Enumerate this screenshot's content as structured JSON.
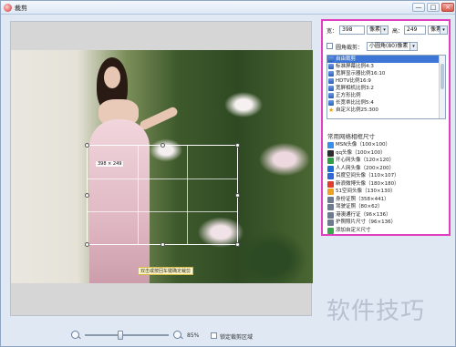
{
  "window": {
    "title": "裁剪"
  },
  "titlebar_buttons": {
    "minimize": "—",
    "maximize": "□",
    "close": "×"
  },
  "canvas": {
    "crop_size_label": "398 × 249",
    "crop_tip": "双击或按回车键确定裁剪"
  },
  "zoom": {
    "percent": "85%",
    "lock_label": "锁定裁剪区域",
    "level": 0.42
  },
  "panel": {
    "width_label": "宽：",
    "width_value": "398",
    "width_unit": "像素",
    "height_label": "高：",
    "height_value": "249",
    "height_unit": "像素",
    "corner_label": "圆角裁剪：",
    "corner_value": "小圆角(80)像素",
    "ratios": [
      {
        "label": "自由裁剪",
        "selected": true
      },
      {
        "label": "标准屏幕比例4:3",
        "selected": false
      },
      {
        "label": "宽屏显示器比例16:10",
        "selected": false
      },
      {
        "label": "HDTV比例16:9",
        "selected": false
      },
      {
        "label": "宽屏相机比例3:2",
        "selected": false
      },
      {
        "label": "正方形比例",
        "selected": false
      },
      {
        "label": "长宽帚比比例5:4",
        "selected": false
      },
      {
        "label": "自定义比例25:300",
        "selected": false,
        "star": true
      }
    ],
    "common_title": "常用网络相框尺寸",
    "common_items": [
      {
        "label": "MSN头像（100×100）",
        "color": "#3a8ee6"
      },
      {
        "label": "qq头像（100×100）",
        "color": "#2c2c2c"
      },
      {
        "label": "开心网头像（120×120）",
        "color": "#2f9e44"
      },
      {
        "label": "人人网头像（200×200）",
        "color": "#1f6fd1"
      },
      {
        "label": "百度空间头像（110×107）",
        "color": "#3166d6"
      },
      {
        "label": "新浪微博头像（180×180）",
        "color": "#e03b2f"
      },
      {
        "label": "51空间头像（130×130）",
        "color": "#f0a020"
      },
      {
        "label": "身份证照（358×441）",
        "color": "#6b7b8f"
      },
      {
        "label": "驾驶证照（80×62）",
        "color": "#6b7b8f"
      },
      {
        "label": "港澳通行证（96×136）",
        "color": "#6b7b8f"
      },
      {
        "label": "护照照片尺寸（96×136）",
        "color": "#6b7b8f"
      },
      {
        "label": "添加自定义尺寸",
        "color": "#3aa64a"
      }
    ]
  },
  "watermark": "软件技巧"
}
